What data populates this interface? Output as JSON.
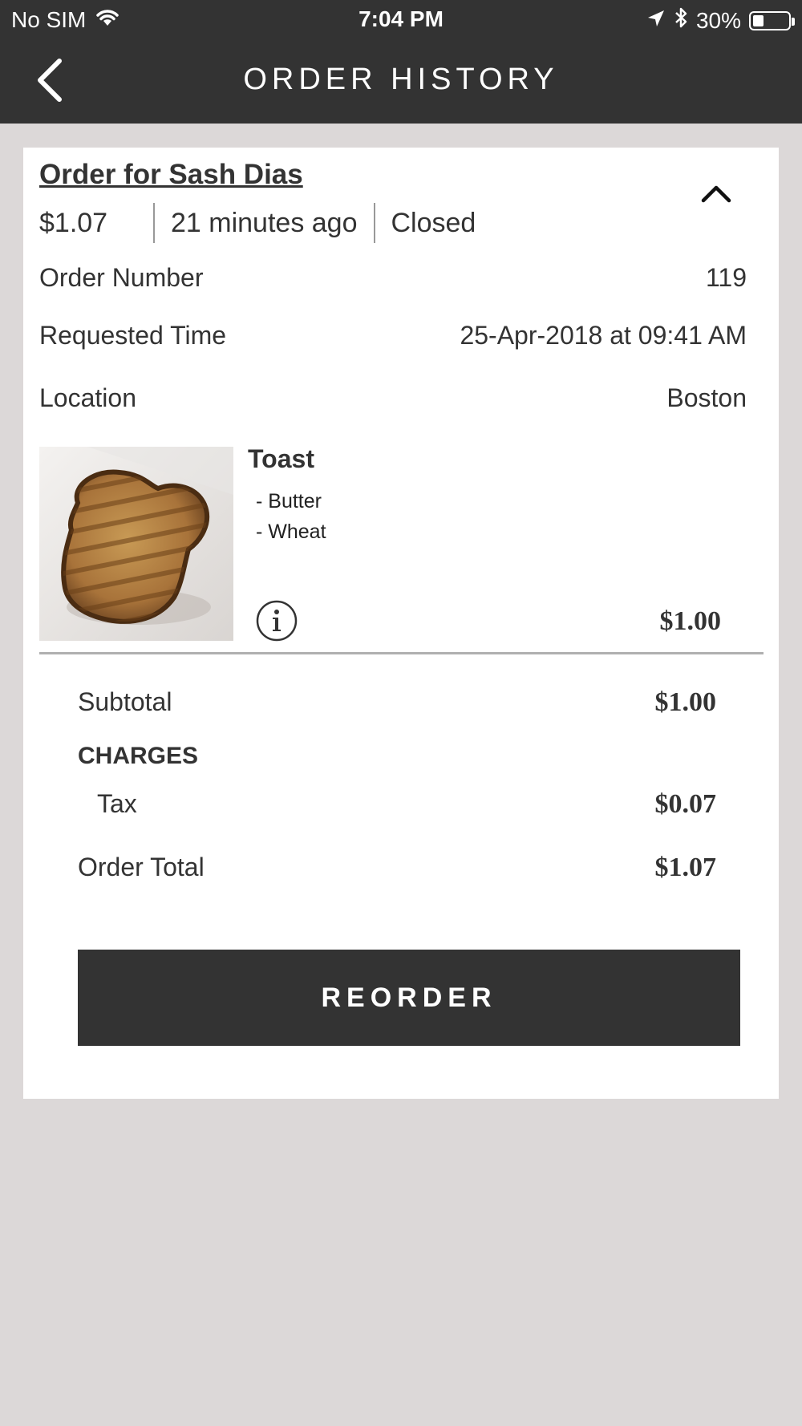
{
  "status_bar": {
    "carrier": "No SIM",
    "time": "7:04 PM",
    "battery_text": "30%",
    "battery_level": 0.3
  },
  "nav": {
    "title": "ORDER HISTORY"
  },
  "order": {
    "title": "Order for Sash Dias",
    "total": "$1.07",
    "time_ago": "21 minutes ago",
    "status": "Closed",
    "details": [
      {
        "label": "Order Number",
        "value": "119"
      },
      {
        "label": "Requested Time",
        "value": "25-Apr-2018 at 09:41 AM"
      },
      {
        "label": "Location",
        "value": "Boston"
      }
    ],
    "item": {
      "name": "Toast",
      "modifiers": [
        "- Butter",
        "- Wheat"
      ],
      "price": "$1.00"
    },
    "subtotal_label": "Subtotal",
    "subtotal": "$1.00",
    "charges_label": "CHARGES",
    "tax_label": "Tax",
    "tax": "$0.07",
    "order_total_label": "Order Total",
    "order_total": "$1.07",
    "reorder_label": "REORDER"
  },
  "icons": {
    "back": "chevron-left-icon",
    "collapse": "chevron-up-icon",
    "info": "info-icon",
    "wifi": "wifi-icon",
    "location": "location-arrow-icon",
    "bluetooth": "bluetooth-icon",
    "battery": "battery-icon"
  },
  "colors": {
    "header": "#333333",
    "background": "#dcd8d8",
    "card": "#ffffff",
    "button": "#333333"
  }
}
